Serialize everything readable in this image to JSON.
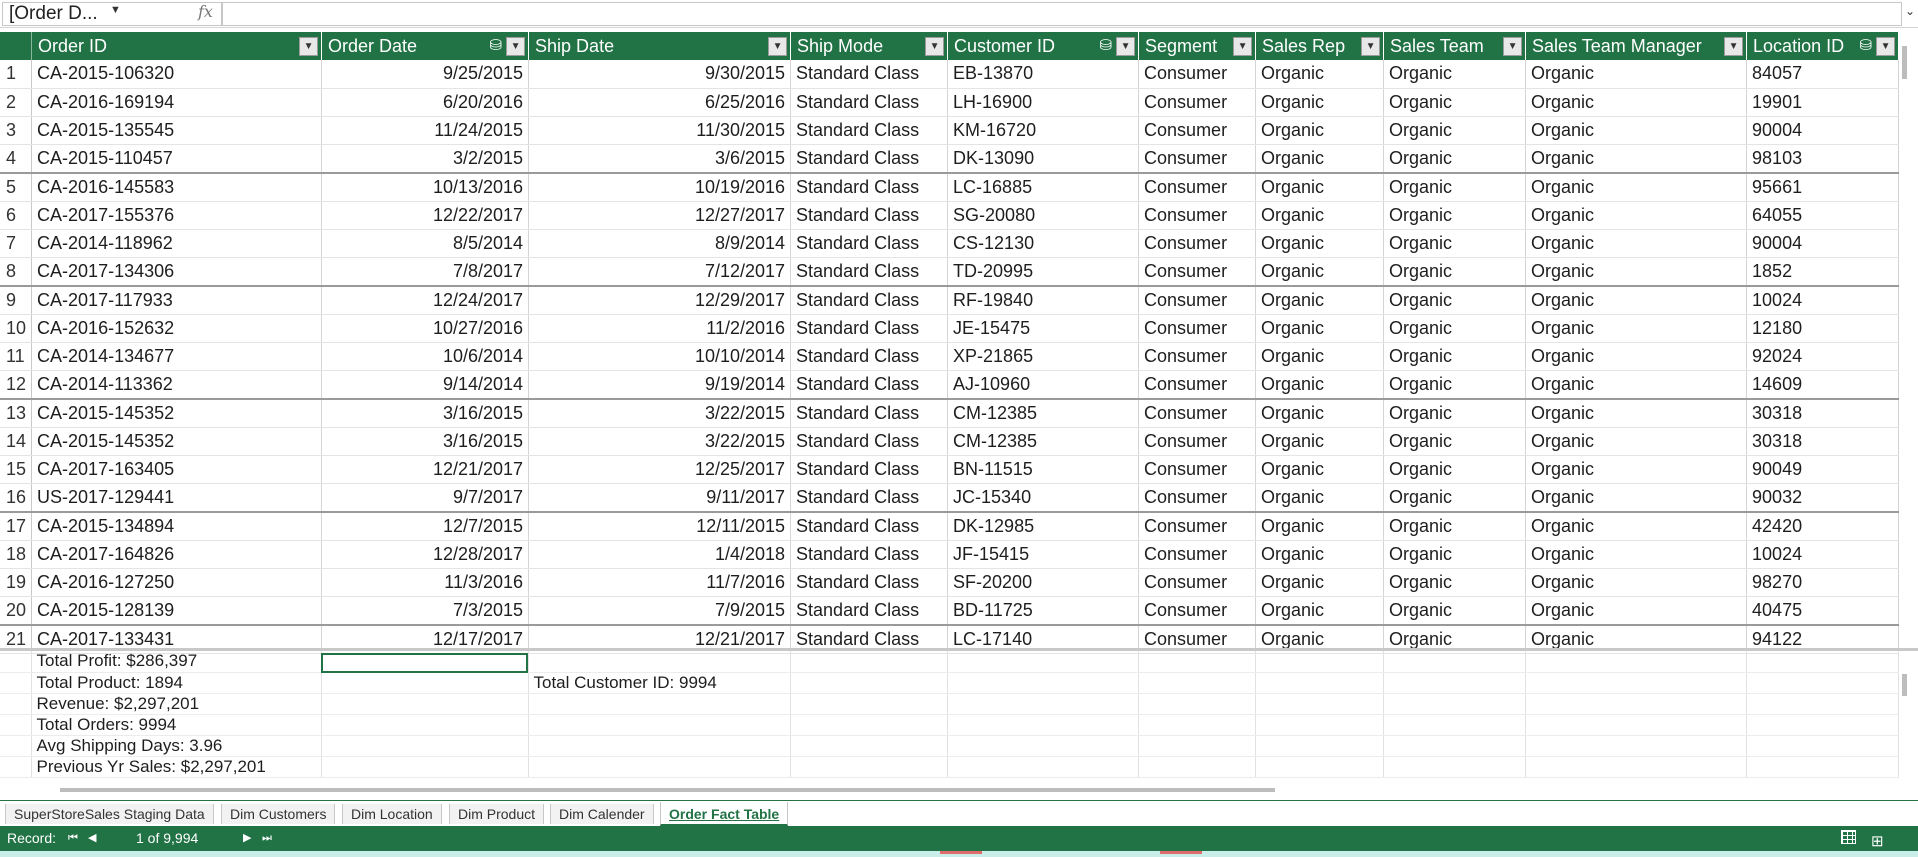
{
  "formula_bar": {
    "name_box": "[Order D...",
    "fx": "fx",
    "formula": ""
  },
  "columns": [
    {
      "label": "Order ID",
      "measure_icon": false
    },
    {
      "label": "Order Date",
      "measure_icon": true
    },
    {
      "label": "Ship Date",
      "measure_icon": false
    },
    {
      "label": "Ship Mode",
      "measure_icon": false
    },
    {
      "label": "Customer ID",
      "measure_icon": true
    },
    {
      "label": "Segment",
      "measure_icon": false
    },
    {
      "label": "Sales Rep",
      "measure_icon": false
    },
    {
      "label": "Sales Team",
      "measure_icon": false
    },
    {
      "label": "Sales Team Manager",
      "measure_icon": false
    },
    {
      "label": "Location ID",
      "measure_icon": true
    }
  ],
  "rows": [
    [
      "1",
      "CA-2015-106320",
      "9/25/2015",
      "9/30/2015",
      "Standard Class",
      "EB-13870",
      "Consumer",
      "Organic",
      "Organic",
      "Organic",
      "84057"
    ],
    [
      "2",
      "CA-2016-169194",
      "6/20/2016",
      "6/25/2016",
      "Standard Class",
      "LH-16900",
      "Consumer",
      "Organic",
      "Organic",
      "Organic",
      "19901"
    ],
    [
      "3",
      "CA-2015-135545",
      "11/24/2015",
      "11/30/2015",
      "Standard Class",
      "KM-16720",
      "Consumer",
      "Organic",
      "Organic",
      "Organic",
      "90004"
    ],
    [
      "4",
      "CA-2015-110457",
      "3/2/2015",
      "3/6/2015",
      "Standard Class",
      "DK-13090",
      "Consumer",
      "Organic",
      "Organic",
      "Organic",
      "98103"
    ],
    [
      "5",
      "CA-2016-145583",
      "10/13/2016",
      "10/19/2016",
      "Standard Class",
      "LC-16885",
      "Consumer",
      "Organic",
      "Organic",
      "Organic",
      "95661"
    ],
    [
      "6",
      "CA-2017-155376",
      "12/22/2017",
      "12/27/2017",
      "Standard Class",
      "SG-20080",
      "Consumer",
      "Organic",
      "Organic",
      "Organic",
      "64055"
    ],
    [
      "7",
      "CA-2014-118962",
      "8/5/2014",
      "8/9/2014",
      "Standard Class",
      "CS-12130",
      "Consumer",
      "Organic",
      "Organic",
      "Organic",
      "90004"
    ],
    [
      "8",
      "CA-2017-134306",
      "7/8/2017",
      "7/12/2017",
      "Standard Class",
      "TD-20995",
      "Consumer",
      "Organic",
      "Organic",
      "Organic",
      "1852"
    ],
    [
      "9",
      "CA-2017-117933",
      "12/24/2017",
      "12/29/2017",
      "Standard Class",
      "RF-19840",
      "Consumer",
      "Organic",
      "Organic",
      "Organic",
      "10024"
    ],
    [
      "10",
      "CA-2016-152632",
      "10/27/2016",
      "11/2/2016",
      "Standard Class",
      "JE-15475",
      "Consumer",
      "Organic",
      "Organic",
      "Organic",
      "12180"
    ],
    [
      "11",
      "CA-2014-134677",
      "10/6/2014",
      "10/10/2014",
      "Standard Class",
      "XP-21865",
      "Consumer",
      "Organic",
      "Organic",
      "Organic",
      "92024"
    ],
    [
      "12",
      "CA-2014-113362",
      "9/14/2014",
      "9/19/2014",
      "Standard Class",
      "AJ-10960",
      "Consumer",
      "Organic",
      "Organic",
      "Organic",
      "14609"
    ],
    [
      "13",
      "CA-2015-145352",
      "3/16/2015",
      "3/22/2015",
      "Standard Class",
      "CM-12385",
      "Consumer",
      "Organic",
      "Organic",
      "Organic",
      "30318"
    ],
    [
      "14",
      "CA-2015-145352",
      "3/16/2015",
      "3/22/2015",
      "Standard Class",
      "CM-12385",
      "Consumer",
      "Organic",
      "Organic",
      "Organic",
      "30318"
    ],
    [
      "15",
      "CA-2017-163405",
      "12/21/2017",
      "12/25/2017",
      "Standard Class",
      "BN-11515",
      "Consumer",
      "Organic",
      "Organic",
      "Organic",
      "90049"
    ],
    [
      "16",
      "US-2017-129441",
      "9/7/2017",
      "9/11/2017",
      "Standard Class",
      "JC-15340",
      "Consumer",
      "Organic",
      "Organic",
      "Organic",
      "90032"
    ],
    [
      "17",
      "CA-2015-134894",
      "12/7/2015",
      "12/11/2015",
      "Standard Class",
      "DK-12985",
      "Consumer",
      "Organic",
      "Organic",
      "Organic",
      "42420"
    ],
    [
      "18",
      "CA-2017-164826",
      "12/28/2017",
      "1/4/2018",
      "Standard Class",
      "JF-15415",
      "Consumer",
      "Organic",
      "Organic",
      "Organic",
      "10024"
    ],
    [
      "19",
      "CA-2016-127250",
      "11/3/2016",
      "11/7/2016",
      "Standard Class",
      "SF-20200",
      "Consumer",
      "Organic",
      "Organic",
      "Organic",
      "98270"
    ],
    [
      "20",
      "CA-2015-128139",
      "7/3/2015",
      "7/9/2015",
      "Standard Class",
      "BD-11725",
      "Consumer",
      "Organic",
      "Organic",
      "Organic",
      "40475"
    ],
    [
      "21",
      "CA-2017-133431",
      "12/17/2017",
      "12/21/2017",
      "Standard Class",
      "LC-17140",
      "Consumer",
      "Organic",
      "Organic",
      "Organic",
      "94122"
    ]
  ],
  "measures": {
    "total_profit": "Total Profit: $286,397",
    "total_product": "Total Product: 1894",
    "revenue": "Revenue: $2,297,201",
    "total_orders": "Total Orders: 9994",
    "avg_shipping_days": "Avg Shipping Days: 3.96",
    "previous_yr_sales": "Previous Yr Sales: $2,297,201",
    "total_customer_id": "Total Customer ID: 9994"
  },
  "sheet_tabs": [
    {
      "label": "SuperStoreSales Staging Data",
      "active": false
    },
    {
      "label": "Dim Customers",
      "active": false
    },
    {
      "label": "Dim Location",
      "active": false
    },
    {
      "label": "Dim Product",
      "active": false
    },
    {
      "label": "Dim Calender",
      "active": false
    },
    {
      "label": "Order Fact Table",
      "active": true
    }
  ],
  "status": {
    "record_label": "Record:",
    "record_value": "1 of 9,994"
  },
  "colors": {
    "accent": "#217346",
    "header_text": "#ffffff"
  }
}
